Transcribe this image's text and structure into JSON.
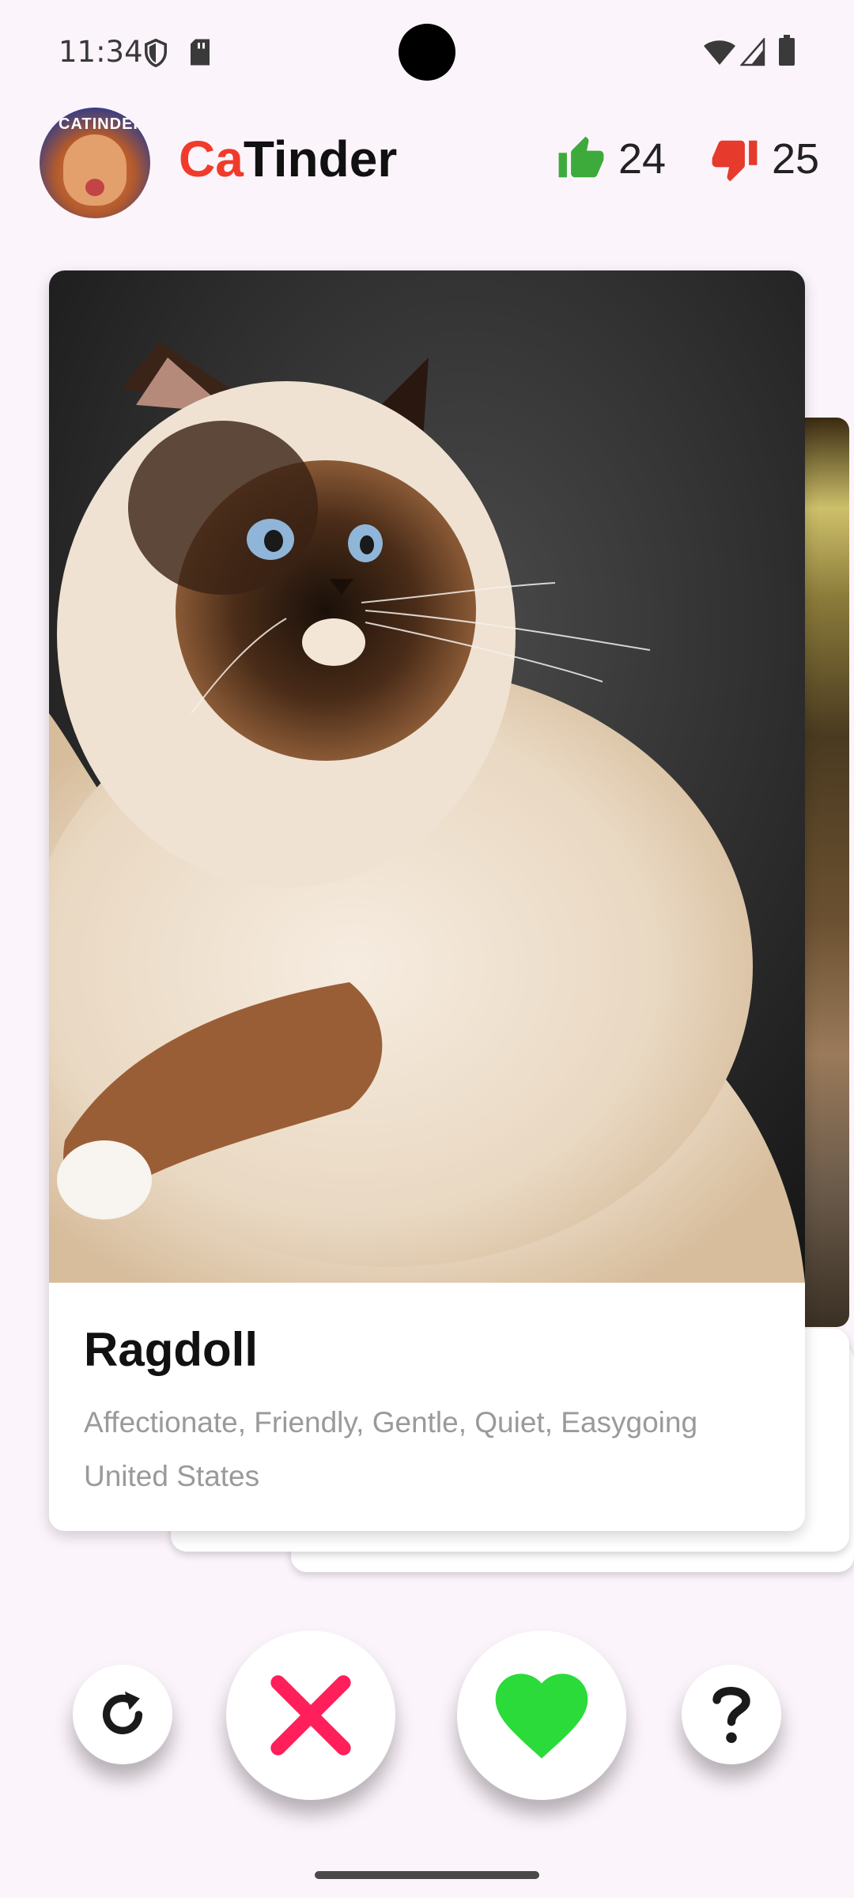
{
  "status_bar": {
    "time": "11:34",
    "icons": [
      "shield-icon",
      "sd-card-icon",
      "wifi-icon",
      "signal-icon",
      "battery-icon"
    ]
  },
  "header": {
    "logo_text": "CATINDER",
    "title_accent": "Ca",
    "title_rest": "Tinder",
    "likes_count": "24",
    "dislikes_count": "25",
    "like_color": "#3cab3c",
    "dislike_color": "#e53a2c"
  },
  "card": {
    "name": "Ragdoll",
    "temperament": "Affectionate, Friendly, Gentle, Quiet, Easygoing",
    "origin": "United States"
  },
  "actions": {
    "undo_icon": "refresh-icon",
    "dislike_icon": "x-icon",
    "like_icon": "heart-icon",
    "info_icon": "question-icon",
    "dislike_color": "#ff1f5a",
    "like_color": "#2bdb3a"
  }
}
